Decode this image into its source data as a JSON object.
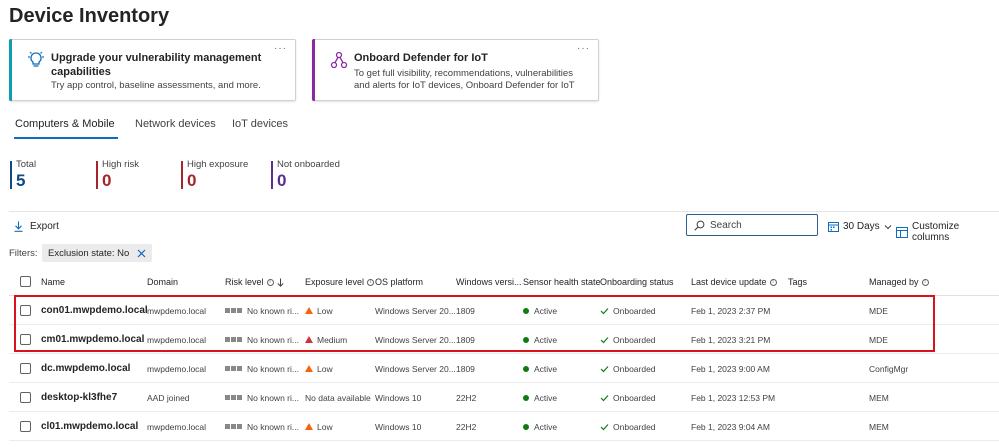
{
  "page_title": "Device Inventory",
  "cards": [
    {
      "title": "Upgrade your vulnerability management capabilities",
      "description": "Try app control, baseline assessments, and more.",
      "accent": "#0f9bb0",
      "icon": "lightbulb-icon"
    },
    {
      "title": "Onboard Defender for IoT",
      "description": "To get full visibility, recommendations, vulnerabilities and alerts for IoT devices, Onboard Defender for IoT",
      "accent": "#8a2aa0",
      "icon": "iot-network-icon"
    }
  ],
  "card_more": "···",
  "tabs": [
    "Computers & Mobile",
    "Network devices",
    "IoT devices"
  ],
  "active_tab": "Computers & Mobile",
  "stats": [
    {
      "label": "Total",
      "value": "5",
      "color": "#0f4a85"
    },
    {
      "label": "High risk",
      "value": "0",
      "color": "#a4262c"
    },
    {
      "label": "High exposure",
      "value": "0",
      "color": "#a4262c"
    },
    {
      "label": "Not onboarded",
      "value": "0",
      "color": "#5c2e91"
    }
  ],
  "toolbar": {
    "export_label": "Export",
    "search_placeholder": "Search",
    "days_label": "30 Days",
    "customize_label": "Customize columns"
  },
  "filters": {
    "label": "Filters:",
    "chip": "Exclusion state: No"
  },
  "table": {
    "columns": [
      "Name",
      "Domain",
      "Risk level",
      "Exposure level",
      "OS platform",
      "Windows versi...",
      "Sensor health state",
      "Onboarding status",
      "Last device update",
      "Tags",
      "Managed by"
    ],
    "rows": [
      {
        "name": "con01.mwpdemo.local",
        "domain": "mwpdemo.local",
        "risk": "No known ri...",
        "exposure": "Low",
        "exposure_level": "low",
        "os": "Windows Server 20...",
        "version": "1809",
        "sensor": "Active",
        "onboarding": "Onboarded",
        "last_update": "Feb 1, 2023 2:37 PM",
        "tags": "",
        "managed_by": "MDE"
      },
      {
        "name": "cm01.mwpdemo.local",
        "domain": "mwpdemo.local",
        "risk": "No known ri...",
        "exposure": "Medium",
        "exposure_level": "medium",
        "os": "Windows Server 20...",
        "version": "1809",
        "sensor": "Active",
        "onboarding": "Onboarded",
        "last_update": "Feb 1, 2023 3:21 PM",
        "tags": "",
        "managed_by": "MDE"
      },
      {
        "name": "dc.mwpdemo.local",
        "domain": "mwpdemo.local",
        "risk": "No known ri...",
        "exposure": "Low",
        "exposure_level": "low",
        "os": "Windows Server 20...",
        "version": "1809",
        "sensor": "Active",
        "onboarding": "Onboarded",
        "last_update": "Feb 1, 2023 9:00 AM",
        "tags": "",
        "managed_by": "ConfigMgr"
      },
      {
        "name": "desktop-kl3fhe7",
        "domain": "AAD joined",
        "risk": "No known ri...",
        "exposure": "No data available",
        "exposure_level": "none",
        "os": "Windows 10",
        "version": "22H2",
        "sensor": "Active",
        "onboarding": "Onboarded",
        "last_update": "Feb 1, 2023 12:53 PM",
        "tags": "",
        "managed_by": "MEM"
      },
      {
        "name": "cl01.mwpdemo.local",
        "domain": "mwpdemo.local",
        "risk": "No known ri...",
        "exposure": "Low",
        "exposure_level": "low",
        "os": "Windows 10",
        "version": "22H2",
        "sensor": "Active",
        "onboarding": "Onboarded",
        "last_update": "Feb 1, 2023 9:04 AM",
        "tags": "",
        "managed_by": "MEM"
      }
    ]
  }
}
